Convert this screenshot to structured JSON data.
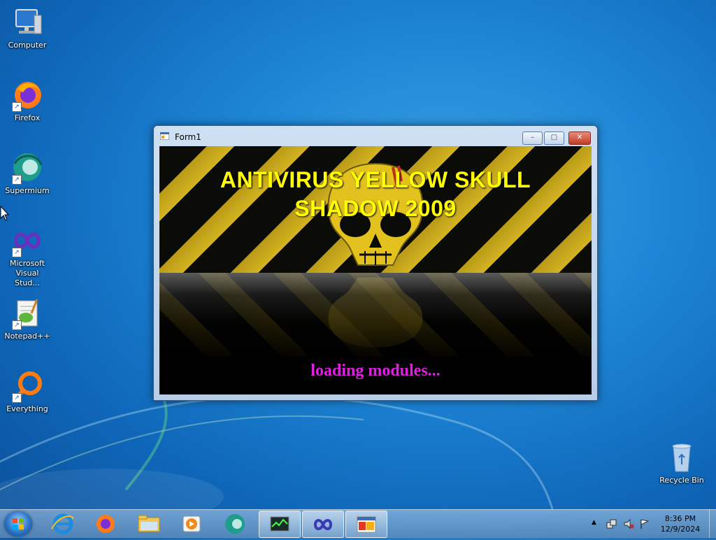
{
  "desktop": {
    "icons": [
      {
        "label": "Computer",
        "icon": "computer-icon"
      },
      {
        "label": "Firefox",
        "icon": "firefox-icon"
      },
      {
        "label": "Supermium",
        "icon": "supermium-icon"
      },
      {
        "label": "Microsoft Visual Stud...",
        "icon": "visual-studio-icon"
      },
      {
        "label": "Notepad++",
        "icon": "notepadpp-icon"
      },
      {
        "label": "Everything",
        "icon": "everything-icon"
      },
      {
        "label": "Recycle Bin",
        "icon": "recycle-bin-icon"
      }
    ]
  },
  "window": {
    "title": "Form1",
    "controls": {
      "minimize": "–",
      "maximize": "□",
      "close": "✕"
    },
    "headline_line1": "ANTIVIRUS YELLOW SKULL",
    "headline_line2": "SHADOW 2009",
    "status": "loading modules..."
  },
  "taskbar": {
    "items": [
      "start-orb",
      "internet-explorer-icon",
      "firefox-icon",
      "file-explorer-icon",
      "media-player-icon",
      "supermium-icon",
      "task-manager-icon",
      "visual-studio-icon",
      "form-app-icon"
    ],
    "tray": {
      "chevron": "▲",
      "time": "8:36 PM",
      "date": "12/9/2024"
    }
  },
  "colors": {
    "headline": "#ffff00",
    "status": "#e020e0",
    "stripe_yellow": "#d4b422"
  }
}
